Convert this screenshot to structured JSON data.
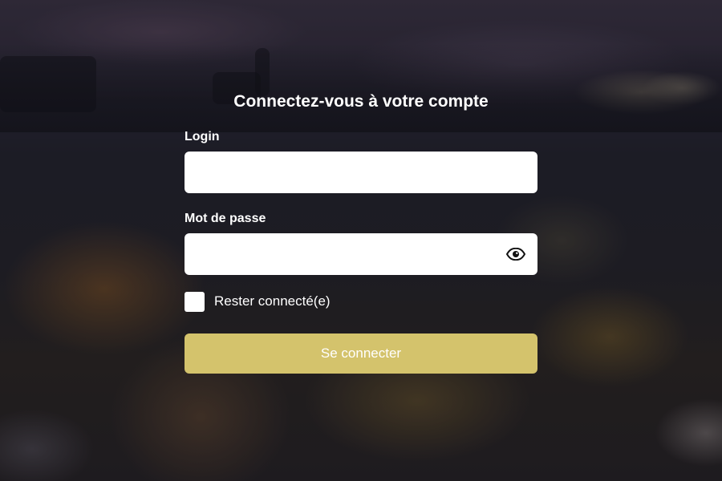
{
  "login_form": {
    "title": "Connectez-vous à votre compte",
    "login_label": "Login",
    "login_value": "",
    "password_label": "Mot de passe",
    "password_value": "",
    "show_password_icon": "eye-icon",
    "remember_label": "Rester connecté(e)",
    "remember_checked": false,
    "submit_label": "Se connecter"
  },
  "colors": {
    "submit_button": "#d4c36c",
    "text": "#ffffff",
    "input_background": "#ffffff"
  }
}
